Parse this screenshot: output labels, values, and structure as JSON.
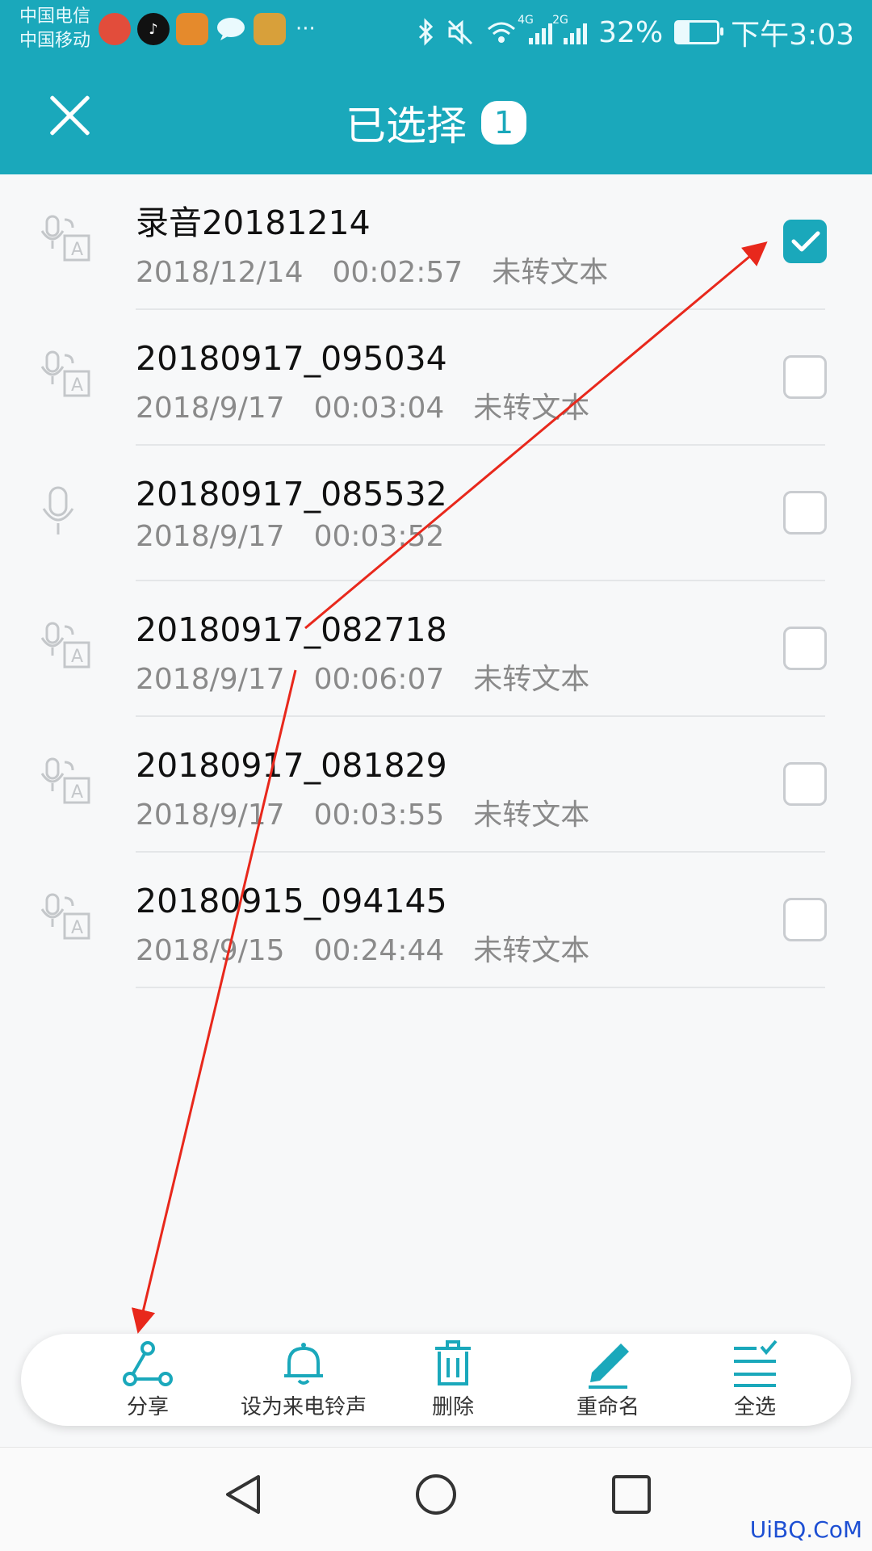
{
  "statusbar": {
    "carrier1": "中国电信",
    "carrier2": "中国移动",
    "app_icons": [
      "qq-browser-icon",
      "tiktok-icon",
      "app-store-icon",
      "message-icon",
      "game-app-icon"
    ],
    "more": "···",
    "net_4g": "4G",
    "net_2g": "2G",
    "battery": "32%",
    "time": "下午3:03"
  },
  "header": {
    "title": "已选择",
    "count": "1",
    "bg": "#1aa8bb"
  },
  "recordings": [
    {
      "name": "录音20181214",
      "date": "2018/12/14",
      "duration": "00:02:57",
      "status": "未转文本",
      "icon": "voice-to-text-icon",
      "checked": true
    },
    {
      "name": "20180917_095034",
      "date": "2018/9/17",
      "duration": "00:03:04",
      "status": "未转文本",
      "icon": "voice-to-text-icon",
      "checked": false
    },
    {
      "name": "20180917_085532",
      "date": "2018/9/17",
      "duration": "00:03:52",
      "status": "",
      "icon": "microphone-icon",
      "checked": false
    },
    {
      "name": "20180917_082718",
      "date": "2018/9/17",
      "duration": "00:06:07",
      "status": "未转文本",
      "icon": "voice-to-text-icon",
      "checked": false
    },
    {
      "name": "20180917_081829",
      "date": "2018/9/17",
      "duration": "00:03:55",
      "status": "未转文本",
      "icon": "voice-to-text-icon",
      "checked": false
    },
    {
      "name": "20180915_094145",
      "date": "2018/9/15",
      "duration": "00:24:44",
      "status": "未转文本",
      "icon": "voice-to-text-icon",
      "checked": false
    }
  ],
  "toolbar": {
    "share": "分享",
    "ringtone": "设为来电铃声",
    "delete": "删除",
    "rename": "重命名",
    "select_all": "全选"
  },
  "watermark": "UiBQ.CoM"
}
